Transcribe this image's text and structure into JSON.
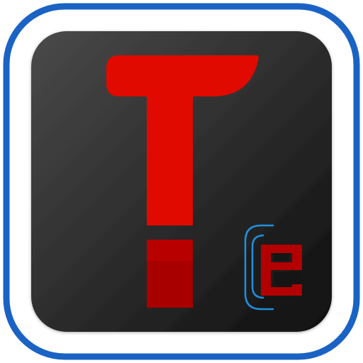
{
  "app_icon": {
    "icon_name": "letter-t-logo-icon",
    "colors": {
      "outer_border": "#1a63c4",
      "outer_fill": "#ffffff",
      "tile_dark": "#111111",
      "tile_light": "#4a4a4a",
      "letter_red": "#e00a00",
      "letter_dark_red": "#a80000",
      "e_glyph_red": "#b30000",
      "bracket_blue": "#1f8fe0"
    }
  }
}
